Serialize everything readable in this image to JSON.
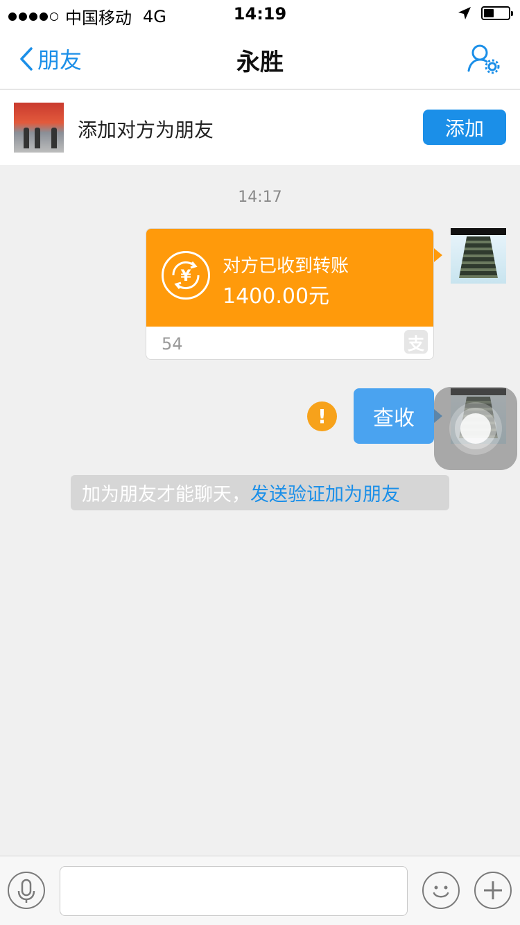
{
  "status_bar": {
    "carrier": "中国移动",
    "network": "4G",
    "time": "14:19",
    "signal_bars": 4,
    "battery_level": 0.4
  },
  "nav": {
    "back_label": "朋友",
    "title": "永胜",
    "icons": {
      "back": "chevron-left-icon",
      "settings": "profile-settings-icon"
    }
  },
  "add_friend_bar": {
    "text": "添加对方为朋友",
    "button_label": "添加"
  },
  "chat": {
    "timestamp": "14:17",
    "transfer": {
      "status": "对方已收到转账",
      "amount": "1400.00元",
      "footer": "54",
      "footer_icon_glyph": "支"
    },
    "check_message": "查收",
    "alert_glyph": "!",
    "system_tip": {
      "text": "加为朋友才能聊天，",
      "link": "发送验证加为朋友"
    }
  },
  "colors": {
    "accent_blue": "#1b8fe8",
    "transfer_orange": "#ff9a0b",
    "bubble_blue": "#4aa3f0",
    "alert_orange": "#f7a21b"
  },
  "input_bar": {
    "input_value": "",
    "icons": {
      "voice": "microphone-icon",
      "emoji": "emoji-icon",
      "more": "plus-icon"
    }
  }
}
